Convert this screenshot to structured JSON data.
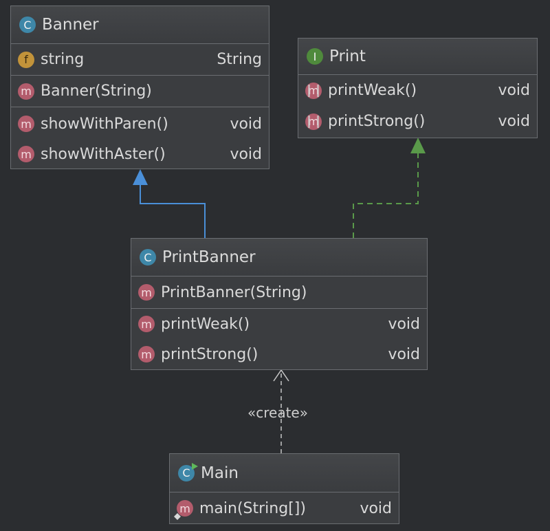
{
  "colors": {
    "background": "#2b2d30",
    "inheritance": "#4a8fd8",
    "realization": "#5a9a4a",
    "dependency": "#c8c8c8"
  },
  "classes": {
    "banner": {
      "kind_icon": "C",
      "title": "Banner",
      "fields": [
        {
          "icon": "f",
          "name": "string",
          "type": "String"
        }
      ],
      "constructors": [
        {
          "icon": "m",
          "name": "Banner(String)"
        }
      ],
      "methods": [
        {
          "icon": "m",
          "name": "showWithParen()",
          "type": "void"
        },
        {
          "icon": "m",
          "name": "showWithAster()",
          "type": "void"
        }
      ]
    },
    "print": {
      "kind_icon": "I",
      "title": "Print",
      "methods": [
        {
          "icon": "m",
          "name": "printWeak()",
          "type": "void"
        },
        {
          "icon": "m",
          "name": "printStrong()",
          "type": "void"
        }
      ]
    },
    "print_banner": {
      "kind_icon": "C",
      "title": "PrintBanner",
      "constructors": [
        {
          "icon": "m",
          "name": "PrintBanner(String)"
        }
      ],
      "methods": [
        {
          "icon": "m",
          "name": "printWeak()",
          "type": "void"
        },
        {
          "icon": "m",
          "name": "printStrong()",
          "type": "void"
        }
      ]
    },
    "main": {
      "kind_icon": "C",
      "title": "Main",
      "methods": [
        {
          "icon": "m",
          "name": "main(String[])",
          "type": "void"
        }
      ]
    }
  },
  "relations": {
    "create_label": "«create»"
  }
}
